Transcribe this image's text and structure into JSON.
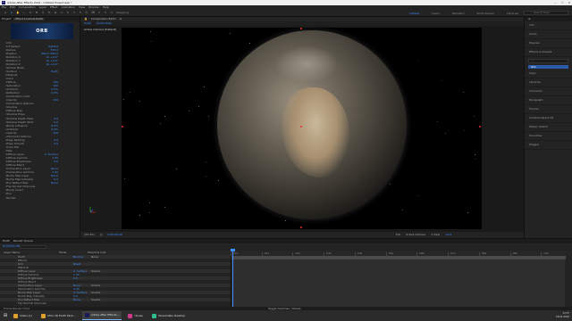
{
  "window": {
    "title": "Adobe After Effects 2022 - Untitled Project.aep *"
  },
  "menu": [
    "File",
    "Edit",
    "Composition",
    "Layer",
    "Effect",
    "Animation",
    "View",
    "Window",
    "Help"
  ],
  "workspaces": [
    "Default",
    "Learn",
    "Standard",
    "Small Screen",
    "Libraries"
  ],
  "workspace_selected": "Default",
  "toolbar": {
    "snapping_label": "Snapping",
    "search_placeholder": "Search Help"
  },
  "effect_controls": {
    "tabs": [
      "Project",
      "Effect Controls Earth"
    ],
    "thumbnail_text": "ORB",
    "rows": [
      {
        "label": "Orb",
        "value": ""
      },
      {
        "label": "Lit Sphere",
        "value": "Lighted"
      },
      {
        "label": "Radius",
        "value": "333.0"
      },
      {
        "label": "Position",
        "value": "960.0, 540.0"
      },
      {
        "label": "Rotation X",
        "value": "0x +0.0°"
      },
      {
        "label": "Rotation Y",
        "value": "0x +0.0°"
      },
      {
        "label": "Rotation Z",
        "value": "0x +0.0°"
      },
      {
        "label": "Sphere Mode",
        "value": ""
      },
      {
        "label": "Surface",
        "value": "Earth"
      },
      {
        "label": "Material",
        "value": ""
      },
      {
        "label": "Color",
        "value": ""
      },
      {
        "label": "Diffuse",
        "value": "100"
      },
      {
        "label": "Saturation",
        "value": "100"
      },
      {
        "label": "Ambient",
        "value": "0.0%"
      },
      {
        "label": "Reflection",
        "value": "0.0%"
      },
      {
        "label": "Illumination Color",
        "value": ""
      },
      {
        "label": "Opacity",
        "value": "100"
      },
      {
        "label": "Illumination Options",
        "value": ""
      },
      {
        "label": "Shadow",
        "value": ""
      },
      {
        "label": "Diffuse Map",
        "value": ""
      },
      {
        "label": "Shadow Edge",
        "value": ""
      },
      {
        "label": "Shadow Depth Fade",
        "value": "0.0"
      },
      {
        "label": "Shadow Depth Start",
        "value": "0.0"
      },
      {
        "label": "Bump Influence",
        "value": "0.0%"
      },
      {
        "label": "Ambient",
        "value": "0.0%"
      },
      {
        "label": "Opacity",
        "value": "100"
      },
      {
        "label": "Advanced Options",
        "value": ""
      },
      {
        "label": "Edge Padding",
        "value": "0.0"
      },
      {
        "label": "Edge Smooth",
        "value": "0.0"
      },
      {
        "label": "Color Mix",
        "value": ""
      },
      {
        "label": "Map",
        "value": ""
      },
      {
        "label": "Diffuse Layer",
        "value": "2. Surface"
      },
      {
        "label": "Diffuse Gamma",
        "value": "1.00"
      },
      {
        "label": "Diffuse Brightness",
        "value": "0.0"
      },
      {
        "label": "Diffuse Blend",
        "value": ""
      },
      {
        "label": "Illumination Layer",
        "value": "None"
      },
      {
        "label": "Illumination Gamma",
        "value": "1.00"
      },
      {
        "label": "Bump Map Layer",
        "value": "None"
      },
      {
        "label": "Bump Map Intensity",
        "value": "0.0"
      },
      {
        "label": "Env Reflect Map",
        "value": "None"
      },
      {
        "label": "Flip Normal Channels",
        "value": ""
      },
      {
        "label": "Bump Invert",
        "value": ""
      },
      {
        "label": "Env",
        "value": ""
      },
      {
        "label": "Render",
        "value": ""
      }
    ]
  },
  "viewer": {
    "tabs": [
      "Composition Earth"
    ],
    "subtabs": [
      "Earth",
      "Earthrotate"
    ],
    "camera_label": "Active Camera (Default)",
    "footer": {
      "zoom": "(33.3%)",
      "timecode": "0;00;00;00",
      "resolution": "Full",
      "camera": "Active Camera",
      "views": "1 View",
      "offset": "+0.0"
    }
  },
  "right_panel": {
    "items": [
      "Info",
      "Audio",
      "Preview",
      "Effects & Presets",
      "Align",
      "Libraries",
      "Character",
      "Paragraph",
      "Tracker",
      "Content-Aware Fill",
      "Motion Sketch",
      "Smoother",
      "Wiggler"
    ],
    "search_placeholder": "",
    "selected_item": "Orb"
  },
  "timeline": {
    "tabs": [
      "Earth",
      "Render Queue"
    ],
    "timecode": "0;00;00;00",
    "columns": [
      "Layer Name",
      "Mode",
      "Parent & Link"
    ],
    "ruler": [
      "00s",
      "01s",
      "02s",
      "03s",
      "04s",
      "05s",
      "06s",
      "07s",
      "08s",
      "09s",
      "10s"
    ],
    "layers": [
      {
        "name": "Earth",
        "mode": "Normal",
        "parent": "None"
      },
      {
        "name": "Effects",
        "mode": "",
        "parent": ""
      },
      {
        "name": "Orb",
        "mode": "Reset",
        "parent": ""
      },
      {
        "name": "Material",
        "mode": "",
        "parent": ""
      },
      {
        "name": "Diffuse Layer",
        "mode": "2. Surface",
        "parent": "Source"
      },
      {
        "name": "Diffuse Gamma",
        "mode": "1.00",
        "parent": ""
      },
      {
        "name": "Diffuse Brightness",
        "mode": "0.0",
        "parent": ""
      },
      {
        "name": "Diffuse Blend",
        "mode": "",
        "parent": ""
      },
      {
        "name": "Illumination Layer",
        "mode": "None",
        "parent": "Source"
      },
      {
        "name": "Illumination Gamma",
        "mode": "1.00",
        "parent": ""
      },
      {
        "name": "Bump Map Layer",
        "mode": "3. Surface",
        "parent": "Source"
      },
      {
        "name": "Bump Map Intensity",
        "mode": "0.0",
        "parent": ""
      },
      {
        "name": "Env Reflect Map",
        "mode": "None",
        "parent": "Source"
      },
      {
        "name": "Flip Normal Channels",
        "mode": "",
        "parent": ""
      }
    ],
    "footer_left": "Frame Render Time",
    "footer_mid": "Toggle Switches / Modes"
  },
  "taskbar": {
    "items": [
      {
        "label": "Video (2)",
        "color": "#e0a030"
      },
      {
        "label": "Ultra 3D Earth Pack...",
        "color": "#e0a030"
      },
      {
        "label": "Adobe After Effects...",
        "color": "#1a1a5a"
      },
      {
        "label": "iTunes",
        "color": "#d03a8a"
      },
      {
        "label": "Streamlabs Desktop",
        "color": "#30c090"
      }
    ],
    "active_index": 2,
    "time": "13:37",
    "date": "18-01-2022"
  },
  "colors": {
    "accent": "#3d8fff",
    "panel": "#232323",
    "background": "#1e1e1e"
  }
}
